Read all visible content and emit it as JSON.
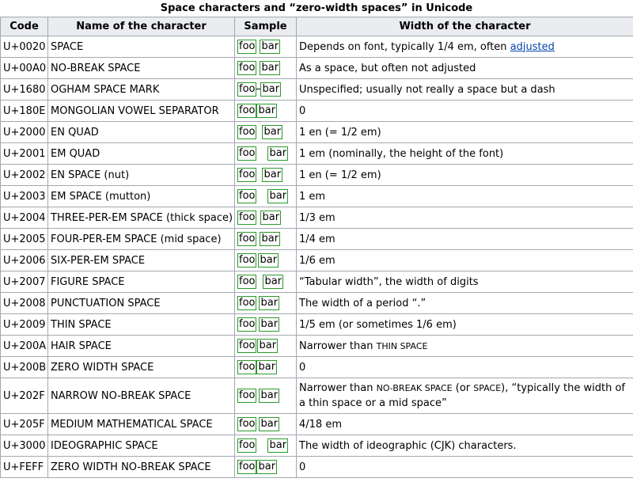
{
  "caption": "Space characters and “zero-width spaces” in Unicode",
  "headers": [
    "Code",
    "Name of the character",
    "Sample",
    "Width of the character"
  ],
  "sample": {
    "left": "foo",
    "right": "bar"
  },
  "rows": [
    {
      "code": "U+0020",
      "name": "SPACE",
      "width_pre": "Depends on font, typically 1/4 em, often ",
      "link": "adjusted"
    },
    {
      "code": "U+00A0",
      "name": "NO-BREAK SPACE",
      "width": "As a space, but often not adjusted"
    },
    {
      "code": "U+1680",
      "name": "OGHAM SPACE MARK",
      "width": "Unspecified; usually not really a space but a dash"
    },
    {
      "code": "U+180E",
      "name": "MONGOLIAN VOWEL SEPARATOR",
      "width": "0"
    },
    {
      "code": "U+2000",
      "name": "EN QUAD",
      "width": "1 en (= 1/2 em)"
    },
    {
      "code": "U+2001",
      "name": "EM QUAD",
      "width": "1 em (nominally, the height of the font)"
    },
    {
      "code": "U+2002",
      "name": "EN SPACE (nut)",
      "width": "1 en (= 1/2 em)"
    },
    {
      "code": "U+2003",
      "name": "EM SPACE (mutton)",
      "width": "1 em"
    },
    {
      "code": "U+2004",
      "name": "THREE-PER-EM SPACE (thick space)",
      "width": "1/3 em"
    },
    {
      "code": "U+2005",
      "name": "FOUR-PER-EM SPACE (mid space)",
      "width": "1/4 em"
    },
    {
      "code": "U+2006",
      "name": "SIX-PER-EM SPACE",
      "width": "1/6 em"
    },
    {
      "code": "U+2007",
      "name": "FIGURE SPACE",
      "width": "“Tabular width”, the width of digits"
    },
    {
      "code": "U+2008",
      "name": "PUNCTUATION SPACE",
      "width": "The width of a period “.”"
    },
    {
      "code": "U+2009",
      "name": "THIN SPACE",
      "width": "1/5 em (or sometimes 1/6 em)"
    },
    {
      "code": "U+200A",
      "name": "HAIR SPACE",
      "width_pre": "Narrower than ",
      "width_sc": "THIN SPACE"
    },
    {
      "code": "U+200B",
      "name": "ZERO WIDTH SPACE",
      "width": "0"
    },
    {
      "code": "U+202F",
      "name": "NARROW NO-BREAK SPACE",
      "width_pre": "Narrower than ",
      "width_sc": "NO-BREAK SPACE",
      "width_mid": " (or ",
      "width_sc2": "SPACE",
      "width_post": "), “typically the width of a thin space or a mid space”"
    },
    {
      "code": "U+205F",
      "name": "MEDIUM MATHEMATICAL SPACE",
      "width": "4/18 em"
    },
    {
      "code": "U+3000",
      "name": "IDEOGRAPHIC SPACE",
      "width": "The width of ideographic (CJK) characters."
    },
    {
      "code": "U+FEFF",
      "name": "ZERO WIDTH NO-BREAK SPACE",
      "width": "0"
    }
  ]
}
